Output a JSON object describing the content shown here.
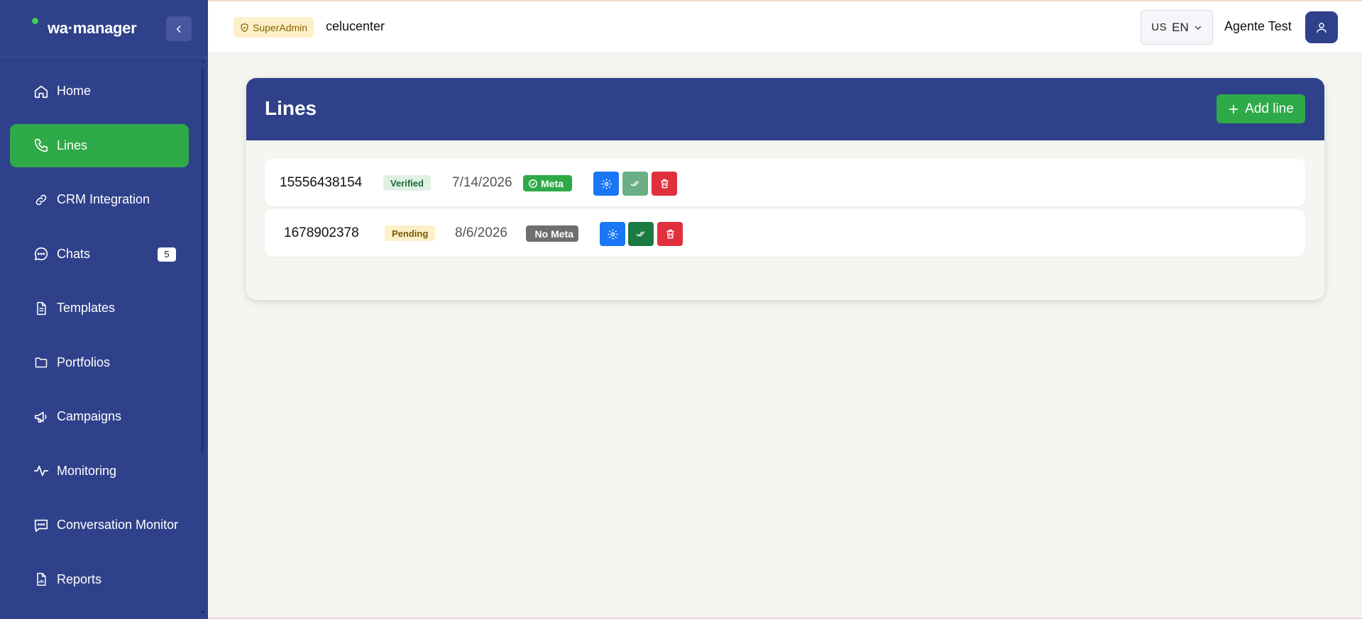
{
  "brand": {
    "logo_text": "wa·manager"
  },
  "sidebar": {
    "items": [
      {
        "label": "Home",
        "icon": "home-icon",
        "active": false
      },
      {
        "label": "Lines",
        "icon": "phone-icon",
        "active": true
      },
      {
        "label": "CRM Integration",
        "icon": "link-icon",
        "active": false
      },
      {
        "label": "Chats",
        "icon": "chat-icon",
        "active": false,
        "badge": "5"
      },
      {
        "label": "Templates",
        "icon": "document-icon",
        "active": false
      },
      {
        "label": "Portfolios",
        "icon": "folder-icon",
        "active": false
      },
      {
        "label": "Campaigns",
        "icon": "megaphone-icon",
        "active": false
      },
      {
        "label": "Monitoring",
        "icon": "activity-icon",
        "active": false
      },
      {
        "label": "Conversation Monitor",
        "icon": "message-square-icon",
        "active": false
      },
      {
        "label": "Reports",
        "icon": "report-icon",
        "active": false
      }
    ]
  },
  "header": {
    "role": "SuperAdmin",
    "company": "celucenter",
    "lang_flag": "US",
    "lang_code": "EN",
    "user_name": "Agente Test"
  },
  "page": {
    "title": "Lines",
    "add_label": "Add line"
  },
  "lines": [
    {
      "phone": "15556438154",
      "status": "Verified",
      "date": "7/14/2026",
      "provider": "Meta"
    },
    {
      "phone": "1678902378",
      "status": "Pending",
      "date": "8/6/2026",
      "provider": "No Meta"
    }
  ],
  "colors": {
    "sidebar_bg": "#2f418a",
    "accent_green": "#2eaa48",
    "config_blue": "#1976f5",
    "delete_red": "#e0303e"
  }
}
